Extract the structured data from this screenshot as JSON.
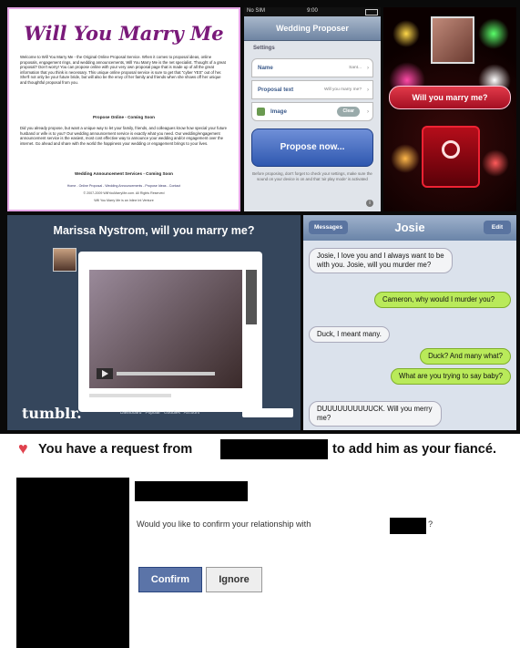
{
  "site": {
    "title": "Will You Marry Me",
    "intro": "Welcome to Will You Marry Me - the Original Online Proposal Service. When it comes to proposal ideas, online proposals, engagement rings, and wedding announcements, Will You Marry Me is the net specialist. Thought of a great proposal? Don't worry! You can propose online with your very own proposal page that is made up of all the great information that you think is necessary. This unique online proposal service is sure to get that \"cyber YES\" out of her. She'll not only be your future bride, but will also be the envy of her family and friends when she shows off her unique and thoughtful proposal from you.",
    "section1": "Propose Online - Coming Soon",
    "para2": "Did you already propose, but want a unique way to let your family, friends, and colleagues know how special your future husband or wife is to you? Our wedding announcement service is exactly what you need. Our wedding/engagement announcement service is the easiest, most cost effective way to announce your wedding and/or engagement over the internet. Go ahead and share with the world the happiness your wedding or engagement brings to your lives.",
    "section2": "Wedding Announcement Services - Coming Soon",
    "footer_links": "Home - Online Proposal - Wedding Announcements - Propose Ideas - Contact",
    "copyright": "© 2007-2009 WillYouMarryMe.com. All Rights Reserved",
    "credit": "Will You Marry Me is an Inline Int Venture"
  },
  "proposer_app": {
    "carrier": "No SIM",
    "time": "9:00",
    "title": "Wedding Proposer",
    "section": "Settings",
    "rows": [
      {
        "label": "Name",
        "value": "Sant..."
      },
      {
        "label": "Proposal text",
        "value": "Will you marry me?"
      },
      {
        "label": "Image",
        "value": "Clear"
      }
    ],
    "button": "Propose now...",
    "note": "Before proposing, don't forget to check your settings, make sure the sound on your device is on and that 'air play mode' is activated"
  },
  "fireworks": {
    "banner": "Will you marry me?"
  },
  "tumblr": {
    "headline": "Marissa Nystrom, will you marry me?",
    "logo": "tumblr.",
    "nav": [
      "Dashboard",
      "Popular",
      "Goodies",
      "Account"
    ]
  },
  "messages": {
    "back": "Messages",
    "contact": "Josie",
    "edit": "Edit",
    "bubbles": [
      {
        "side": "l",
        "text": "Josie, I love you and I always want to be with you. Josie, will you murder me?"
      },
      {
        "side": "r",
        "text": "Cameron, why would I murder you?"
      },
      {
        "side": "l",
        "text": "Duck, I meant many."
      },
      {
        "side": "r",
        "text": "Duck? And many what?"
      },
      {
        "side": "r",
        "text": "What are you trying to say baby?"
      },
      {
        "side": "l",
        "text": "DUUUUUUUUUUCK. Will you merry me?"
      }
    ]
  },
  "facebook": {
    "request_prefix": "You have a request from",
    "request_suffix": "to add him as your fiancé.",
    "question": "Would you like to confirm your relationship with",
    "question_end": "?",
    "confirm": "Confirm",
    "ignore": "Ignore",
    "colors": {
      "confirm": "#5b74a8",
      "heart": "#e0424e"
    }
  }
}
